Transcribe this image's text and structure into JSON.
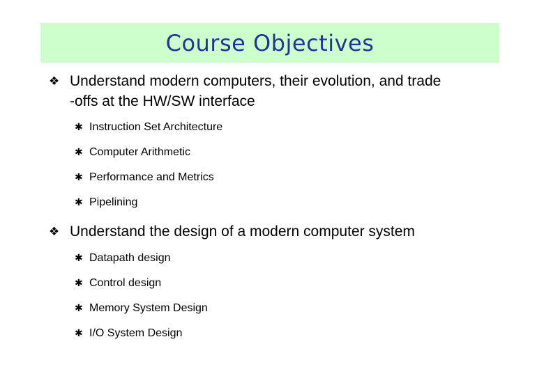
{
  "slide": {
    "title": "Course Objectives",
    "banner_color": "#ccffcc",
    "title_color": "#2233a0",
    "background_color": "#ffffff",
    "text_color": "#000000"
  },
  "bullets": {
    "level1_marker": "❖",
    "level2_marker": "✱",
    "items": [
      {
        "text": "Understand modern computers, their evolution, and trade -offs at the HW/SW interface",
        "line1": "Understand modern computers, their evolution, and trade",
        "line2": "-offs at the HW/SW interface",
        "subitems": [
          "Instruction Set Architecture",
          "Computer Arithmetic",
          "Performance and Metrics",
          "Pipelining"
        ]
      },
      {
        "text": "Understand the design of a modern computer system",
        "line1": "Understand the design of a modern computer system",
        "line2": "",
        "subitems": [
          "Datapath design",
          "Control design",
          "Memory System Design",
          "I/O System Design"
        ]
      }
    ]
  }
}
